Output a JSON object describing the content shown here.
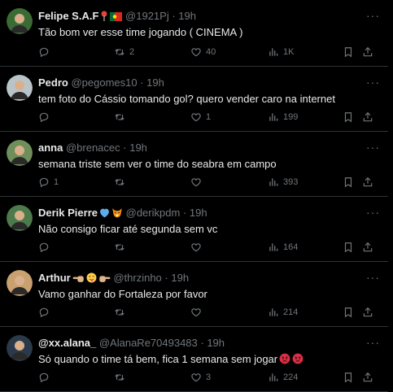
{
  "tweets": [
    {
      "name": "Felipe S.A.F",
      "name_emojis": [
        "pin-emoji",
        "portugal-flag-emoji"
      ],
      "handle": "@1921Pj",
      "time": "19h",
      "text": "Tão bom ver esse time jogando ( CINEMA )",
      "replies": "",
      "retweets": "2",
      "likes": "40",
      "views": "1K",
      "avatar_color": "#3a6b35"
    },
    {
      "name": "Pedro",
      "name_emojis": [],
      "handle": "@pegomes10",
      "time": "19h",
      "text": "tem foto do Cássio tomando gol? quero vender caro na internet",
      "replies": "",
      "retweets": "",
      "likes": "1",
      "views": "199",
      "avatar_color": "#b9c4c9"
    },
    {
      "name": "anna",
      "name_emojis": [],
      "handle": "@brenacec",
      "time": "19h",
      "text": "semana triste sem ver o time do seabra em campo",
      "replies": "1",
      "retweets": "",
      "likes": "",
      "views": "393",
      "avatar_color": "#6f8f5a"
    },
    {
      "name": "Derik Pierre",
      "name_emojis": [
        "blue-heart-emoji",
        "fox-emoji"
      ],
      "handle": "@derikpdm",
      "time": "19h",
      "text": "Não consigo ficar até segunda sem vc",
      "replies": "",
      "retweets": "",
      "likes": "",
      "views": "164",
      "avatar_color": "#4d7a4a"
    },
    {
      "name": "Arthur",
      "name_emojis": [
        "backhand-point-left-emoji",
        "winking-tongue-emoji",
        "backhand-point-right-emoji"
      ],
      "handle": "@thrzinho",
      "time": "19h",
      "text": "Vamo ganhar do Fortaleza por favor",
      "replies": "",
      "retweets": "",
      "likes": "",
      "views": "214",
      "avatar_color": "#c9a070"
    },
    {
      "name": "@xx.alana_",
      "name_emojis": [],
      "handle": "@AlanaRe70493483",
      "time": "19h",
      "text": "Só quando o time tá bem, fica 1 semana sem jogar",
      "text_emojis": [
        "angry-face-emoji",
        "angry-face-emoji"
      ],
      "replies": "",
      "retweets": "",
      "likes": "3",
      "views": "224",
      "avatar_color": "#2b3a4a"
    }
  ],
  "separator": "·",
  "colors": {
    "background": "#000000",
    "text": "#e7e9ea",
    "secondary": "#71767b",
    "border": "#2f3336"
  }
}
